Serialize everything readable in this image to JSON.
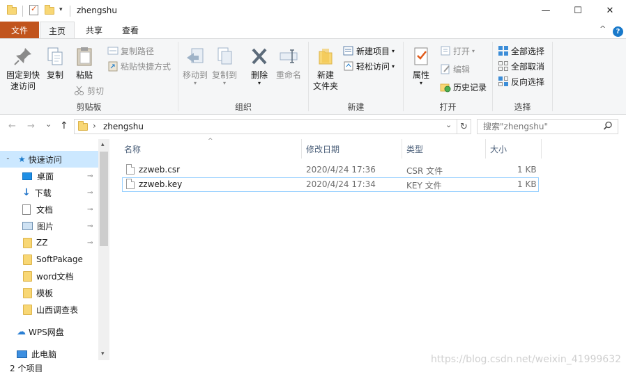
{
  "window": {
    "title": "zhengshu",
    "controls": {
      "minimize": "—",
      "maximize": "☐",
      "close": "✕"
    }
  },
  "ribbon_tabs": [
    "文件",
    "主页",
    "共享",
    "查看"
  ],
  "ribbon_right": {
    "collapse": "^",
    "help": "?"
  },
  "ribbon": {
    "clipboard": {
      "pin_quick_access": [
        "固定到快",
        "速访问"
      ],
      "copy": "复制",
      "paste": "粘贴",
      "copy_path": "复制路径",
      "paste_shortcut": "粘贴快捷方式",
      "cut": "剪切",
      "group_label": "剪贴板"
    },
    "organize": {
      "move_to": "移动到",
      "copy_to": "复制到",
      "delete": "删除",
      "rename": "重命名",
      "group_label": "组织"
    },
    "new": {
      "new_folder": [
        "新建",
        "文件夹"
      ],
      "new_item": "新建项目",
      "easy_access": "轻松访问",
      "group_label": "新建"
    },
    "open": {
      "properties": "属性",
      "open": "打开",
      "edit": "编辑",
      "history": "历史记录",
      "group_label": "打开"
    },
    "select": {
      "select_all": "全部选择",
      "select_none": "全部取消",
      "invert": "反向选择",
      "group_label": "选择"
    }
  },
  "address": {
    "back": "←",
    "forward": "→",
    "recent": "⌄",
    "up": "↑",
    "separator": "›",
    "path": "zhengshu",
    "refresh": "↻",
    "dropdown": "⌄",
    "search_placeholder": "搜索\"zhengshu\""
  },
  "nav_pane": {
    "quick_access": "快速访问",
    "items": [
      {
        "label": "桌面",
        "pinned": true,
        "icon": "desktop-icon"
      },
      {
        "label": "下载",
        "pinned": true,
        "icon": "download-icon"
      },
      {
        "label": "文档",
        "pinned": true,
        "icon": "document-icon"
      },
      {
        "label": "图片",
        "pinned": true,
        "icon": "picture-icon"
      },
      {
        "label": "ZZ",
        "pinned": true,
        "icon": "folder-icon"
      },
      {
        "label": "SoftPakage",
        "pinned": false,
        "icon": "folder-icon"
      },
      {
        "label": "word文档",
        "pinned": false,
        "icon": "folder-icon"
      },
      {
        "label": "模板",
        "pinned": false,
        "icon": "folder-icon"
      },
      {
        "label": "山西调查表",
        "pinned": false,
        "icon": "folder-icon"
      }
    ],
    "wps": "WPS网盘",
    "this_pc": "此电脑",
    "pin_glyph": "📌"
  },
  "file_list": {
    "columns": [
      "名称",
      "修改日期",
      "类型",
      "大小"
    ],
    "rows": [
      {
        "name": "zzweb.csr",
        "date": "2020/4/24 17:36",
        "type": "CSR 文件",
        "size": "1 KB"
      },
      {
        "name": "zzweb.key",
        "date": "2020/4/24 17:34",
        "type": "KEY 文件",
        "size": "1 KB"
      }
    ]
  },
  "status": {
    "count": "2 个项目"
  },
  "watermark": "https://blog.csdn.net/weixin_41999632",
  "colors": {
    "file_tab": "#c1541d",
    "selection": "#cce8ff",
    "accent": "#1979ca"
  }
}
